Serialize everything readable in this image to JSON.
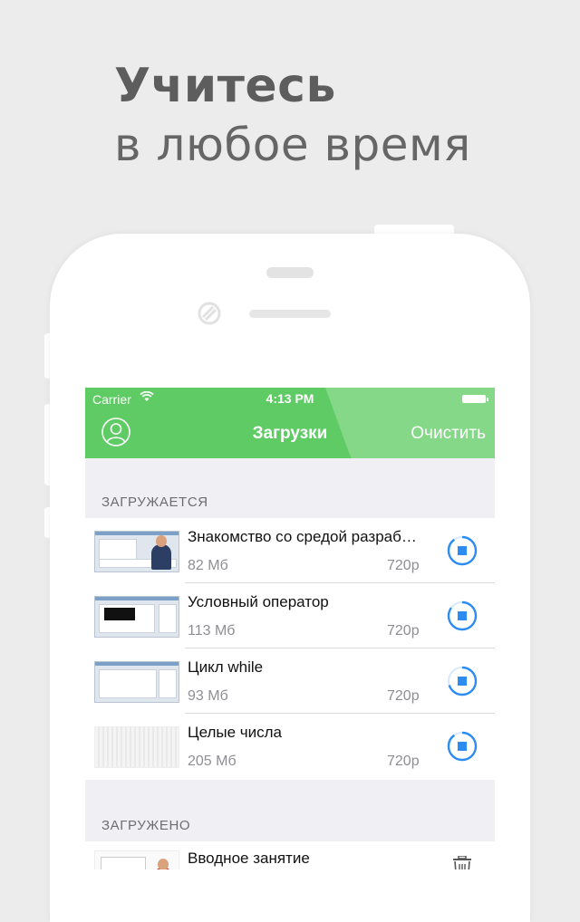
{
  "headline": {
    "line1": "Учитесь",
    "line2": "в любое время"
  },
  "status_bar": {
    "carrier": "Carrier",
    "time": "4:13 PM"
  },
  "navbar": {
    "title": "Загрузки",
    "action": "Очистить"
  },
  "sections": {
    "downloading": {
      "label": "ЗАГРУЖАЕТСЯ",
      "items": [
        {
          "title": "Знакомство со средой разраб…",
          "size": "82 Мб",
          "quality": "720p",
          "icon": "download-progress-icon",
          "progress": 0.9
        },
        {
          "title": "Условный оператор",
          "size": "113 Мб",
          "quality": "720p",
          "icon": "download-progress-icon",
          "progress": 0.85
        },
        {
          "title": "Цикл while",
          "size": "93 Мб",
          "quality": "720p",
          "icon": "download-progress-icon",
          "progress": 0.7
        },
        {
          "title": "Целые числа",
          "size": "205 Мб",
          "quality": "720p",
          "icon": "download-progress-icon",
          "progress": 0.9
        }
      ]
    },
    "downloaded": {
      "label": "ЗАГРУЖЕНО",
      "items": [
        {
          "title": "Вводное занятие",
          "icon": "trash-icon"
        }
      ]
    }
  },
  "colors": {
    "accent_green": "#5fcb64",
    "progress_blue": "#2d8cf0"
  }
}
